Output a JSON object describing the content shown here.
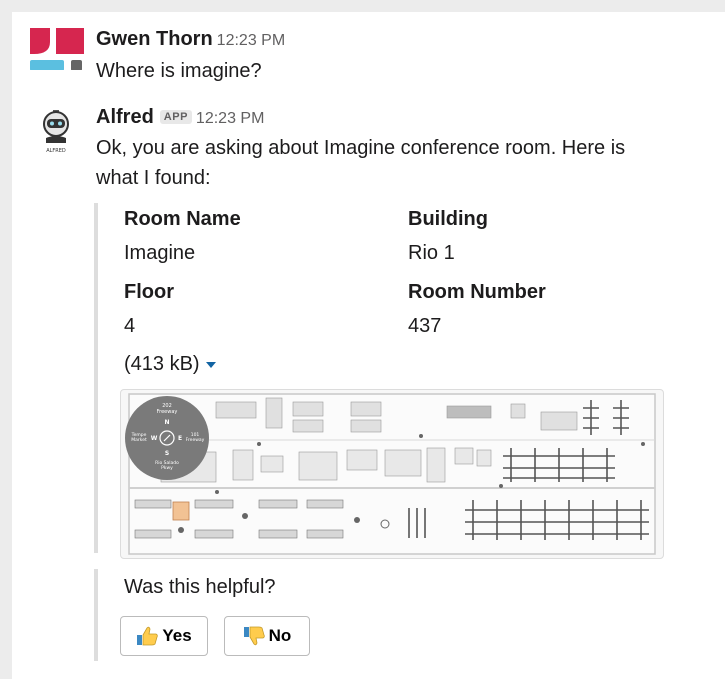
{
  "messages": [
    {
      "author": "Gwen Thorn",
      "time": "12:23 PM",
      "text": "Where is imagine?"
    },
    {
      "author": "Alfred",
      "badge": "APP",
      "time": "12:23 PM",
      "text_line1": "Ok, you are asking about Imagine conference room. Here is",
      "text_line2": "what I found:",
      "avatar_caption": "ALFRED"
    }
  ],
  "room": {
    "name_label": "Room Name",
    "name_value": "Imagine",
    "building_label": "Building",
    "building_value": "Rio 1",
    "floor_label": "Floor",
    "floor_value": "4",
    "number_label": "Room Number",
    "number_value": "437"
  },
  "file": {
    "size": "(413 kB)"
  },
  "map": {
    "compass_top": "202",
    "compass_top2": "Freeway",
    "compass_n": "N",
    "compass_w": "W",
    "compass_e": "E",
    "compass_s": "S",
    "compass_left": "Tempe",
    "compass_left2": "Market",
    "compass_right": "101",
    "compass_right2": "Freeway",
    "compass_bottom": "Rio Salado",
    "compass_bottom2": "Pkwy"
  },
  "feedback": {
    "question": "Was this helpful?",
    "yes": "Yes",
    "no": "No"
  },
  "colors": {
    "logo_red": "#d6264f",
    "logo_blue": "#5bbfe0",
    "logo_gray": "#666666",
    "highlight": "#f2c294"
  }
}
